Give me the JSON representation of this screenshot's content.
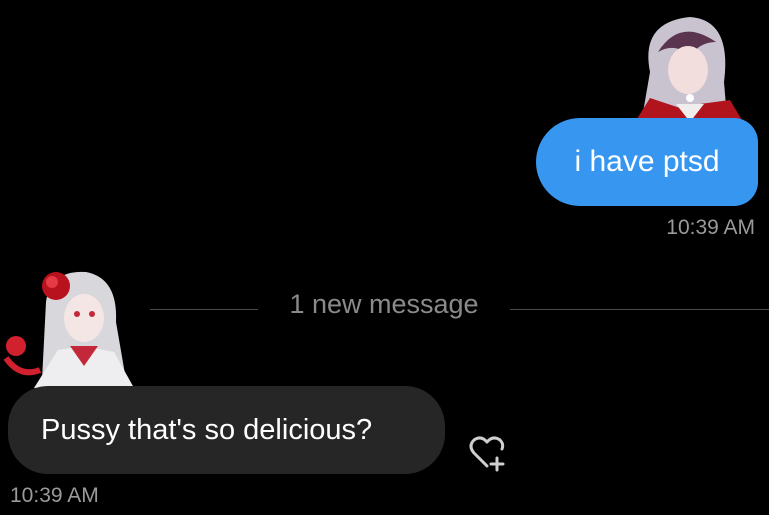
{
  "conversation": {
    "outgoing": {
      "text": "i have ptsd",
      "time": "10:39 AM"
    },
    "divider": {
      "label": "1 new message"
    },
    "incoming": {
      "text": "Pussy that's so delicious?",
      "time": "10:39 AM"
    }
  },
  "icons": {
    "react": "heart-plus-icon"
  },
  "colors": {
    "outgoing_bubble": "#3797f0",
    "incoming_bubble": "#262626",
    "background": "#000000"
  }
}
